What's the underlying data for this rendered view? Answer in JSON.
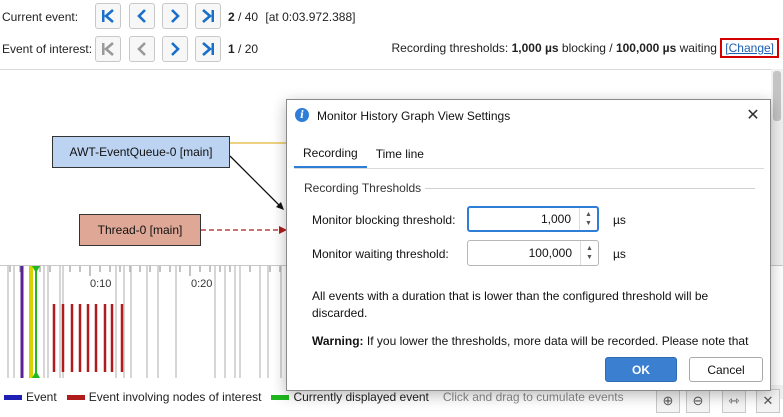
{
  "nav": {
    "current_event": {
      "label": "Current event:",
      "index": "2",
      "total": "/ 40",
      "time": "[at 0:03.972.388]"
    },
    "event_of_interest": {
      "label": "Event of interest:",
      "index": "1",
      "total": "/ 20"
    }
  },
  "thresholds": {
    "prefix": "Recording thresholds:",
    "blocking_value": "1,000 µs",
    "blocking_label": "blocking /",
    "waiting_value": "100,000 µs",
    "waiting_label": "waiting",
    "change_link": "[Change]"
  },
  "graph": {
    "threads": [
      {
        "name": "AWT-EventQueue-0 [main]"
      },
      {
        "name": "Thread-0 [main]"
      }
    ]
  },
  "timeline": {
    "ticks": [
      "0:10",
      "0:20"
    ]
  },
  "legend": {
    "event": "Event",
    "interest": "Event involving nodes of interest",
    "current": "Currently displayed event",
    "hint": "Click and drag to cumulate events"
  },
  "dialog": {
    "title": "Monitor History Graph View Settings",
    "tabs": [
      "Recording",
      "Time line"
    ],
    "section": "Recording Thresholds",
    "blocking": {
      "label": "Monitor blocking threshold:",
      "value": "1,000",
      "unit": "µs"
    },
    "waiting": {
      "label": "Monitor waiting threshold:",
      "value": "100,000",
      "unit": "µs"
    },
    "info": "All events with a duration that is lower than the configured threshold will be discarded.",
    "warning_label": "Warning:",
    "warning_text": "If you lower the thresholds, more data will be recorded. Please note that",
    "ok": "OK",
    "cancel": "Cancel"
  },
  "colors": {
    "accent": "#2e7dd7",
    "event": "#1f1fb4",
    "interest": "#b01c1c",
    "current": "#1fb81f",
    "highlight": "#d40000"
  }
}
